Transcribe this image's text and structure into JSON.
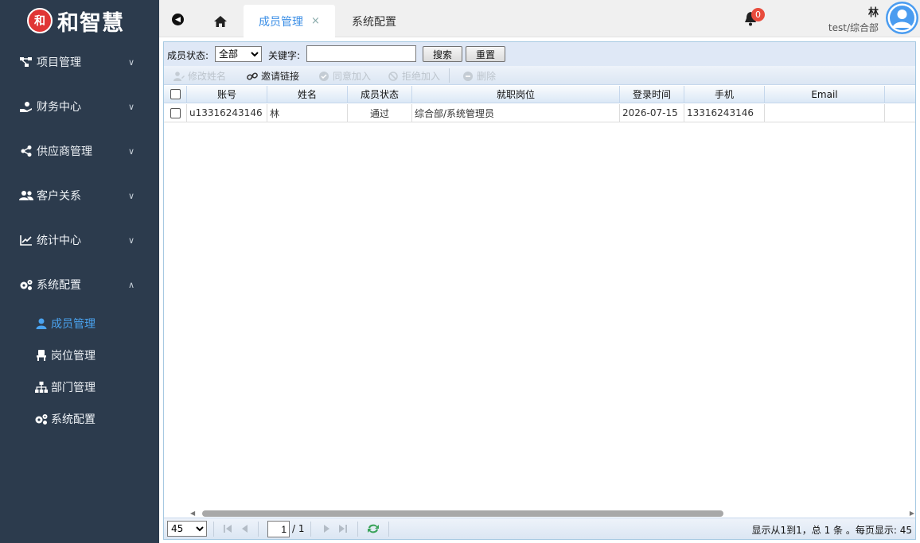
{
  "app": {
    "logo_mark": "和",
    "logo_text": "和智慧"
  },
  "sidebar": {
    "groups": [
      {
        "label": "项目管理",
        "icon": "project-icon"
      },
      {
        "label": "财务中心",
        "icon": "finance-icon"
      },
      {
        "label": "供应商管理",
        "icon": "share-icon"
      },
      {
        "label": "客户关系",
        "icon": "users-icon"
      },
      {
        "label": "统计中心",
        "icon": "chart-icon"
      },
      {
        "label": "系统配置",
        "icon": "gears-icon"
      }
    ],
    "sub_items": [
      {
        "label": "成员管理",
        "icon": "user-icon",
        "active": true
      },
      {
        "label": "岗位管理",
        "icon": "chair-icon",
        "active": false
      },
      {
        "label": "部门管理",
        "icon": "sitemap-icon",
        "active": false
      },
      {
        "label": "系统配置",
        "icon": "gears-icon",
        "active": false
      }
    ],
    "colors": {
      "background": "#2c3b4d",
      "active": "#4aa3f0"
    }
  },
  "topbar": {
    "tabs": [
      {
        "label": "成员管理",
        "close": "×",
        "active": true
      },
      {
        "label": "系统配置",
        "active": false
      }
    ],
    "notification_count": "0",
    "user": {
      "name": "林",
      "org": "test/综合部"
    }
  },
  "search": {
    "status_label": "成员状态:",
    "status_value": "全部",
    "keyword_label": "关键字:",
    "keyword_value": "",
    "search_label": "搜索",
    "reset_label": "重置"
  },
  "toolbar": {
    "edit_name": "修改姓名",
    "invite_link": "邀请链接",
    "approve": "同意加入",
    "reject": "拒绝加入",
    "delete": "删除"
  },
  "grid": {
    "columns": [
      "账号",
      "姓名",
      "成员状态",
      "就职岗位",
      "登录时间",
      "手机",
      "Email"
    ],
    "rows": [
      {
        "account": "u13316243146",
        "name": "林",
        "status": "通过",
        "position": "综合部/系统管理员",
        "login_time": "2026-07-15",
        "phone": "13316243146",
        "email": ""
      }
    ]
  },
  "pager": {
    "page_size": "45",
    "page_current": "1",
    "page_total": "/ 1",
    "info": "显示从1到1，总 1 条 。每页显示: 45"
  }
}
